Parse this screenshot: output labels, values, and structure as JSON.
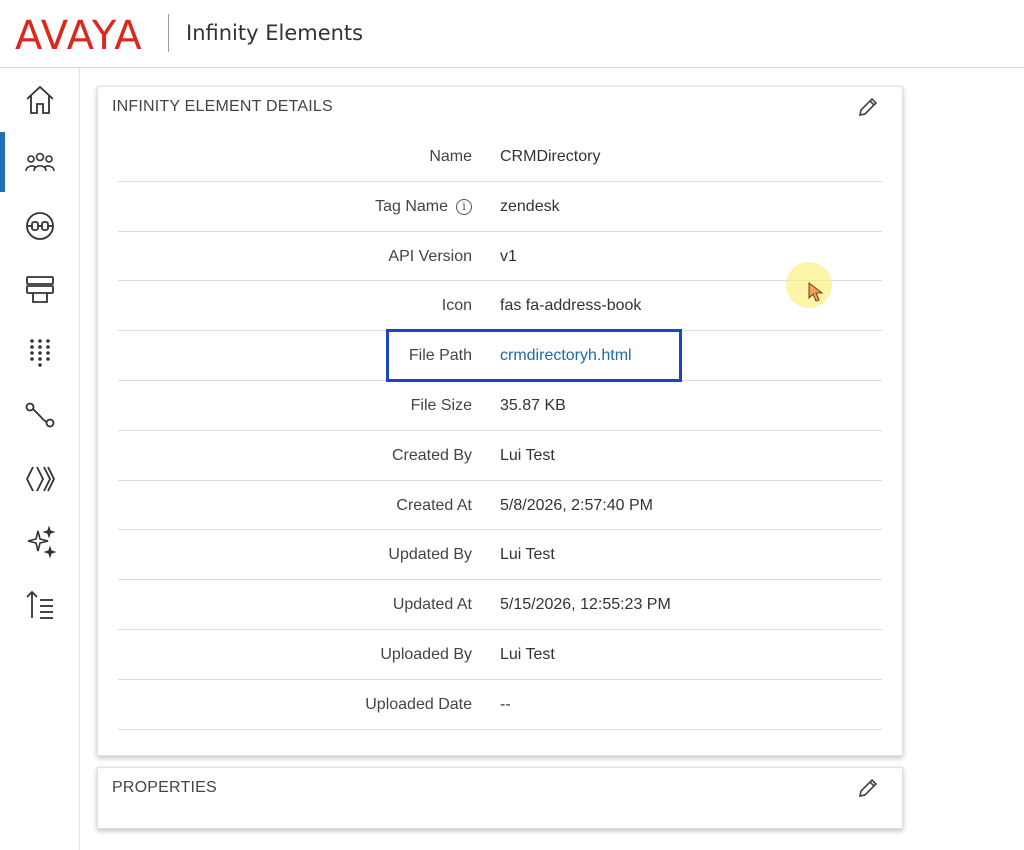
{
  "header": {
    "brand": "AVAYA",
    "app_title": "Infinity Elements",
    "brand_color": "#da291c"
  },
  "sidebar": {
    "items": [
      {
        "icon": "home-icon",
        "active": false
      },
      {
        "icon": "users-icon",
        "active": true
      },
      {
        "icon": "connector-icon",
        "active": false
      },
      {
        "icon": "stack-icon",
        "active": false
      },
      {
        "icon": "dialpad-icon",
        "active": false
      },
      {
        "icon": "flow-icon",
        "active": false
      },
      {
        "icon": "chevrons-icon",
        "active": false
      },
      {
        "icon": "sparkles-icon",
        "active": false
      },
      {
        "icon": "sort-list-icon",
        "active": false
      }
    ],
    "active_color": "#1f6fb5"
  },
  "details": {
    "title": "INFINITY ELEMENT DETAILS",
    "rows": [
      {
        "label": "Name",
        "value": "CRMDirectory"
      },
      {
        "label": "Tag Name",
        "value": "zendesk"
      },
      {
        "label": "API Version",
        "value": "v1"
      },
      {
        "label": "Icon",
        "value": "fas fa-address-book"
      },
      {
        "label": "File Path",
        "value": "crmdirectoryh.html"
      },
      {
        "label": "File Size",
        "value": "35.87 KB"
      },
      {
        "label": "Created By",
        "value": "Lui Test"
      },
      {
        "label": "Created At",
        "value": "5/8/2026, 2:57:40 PM"
      },
      {
        "label": "Updated By",
        "value": "Lui Test"
      },
      {
        "label": "Updated At",
        "value": "5/15/2026, 12:55:23 PM"
      },
      {
        "label": "Uploaded By",
        "value": "Lui Test"
      },
      {
        "label": "Uploaded Date",
        "value": "--"
      }
    ],
    "link_color": "#1f6a9e",
    "highlight_color": "#1747c5"
  },
  "properties": {
    "title": "PROPERTIES"
  }
}
